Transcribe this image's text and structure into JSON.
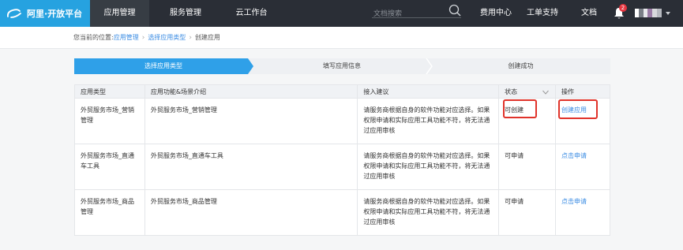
{
  "nav": {
    "logo_text": "阿里·开放平台",
    "items": [
      "应用管理",
      "服务管理",
      "云工作台"
    ],
    "search_placeholder": "文档搜索",
    "right_items": [
      "费用中心",
      "工单支持",
      "文档"
    ],
    "notification_count": "2"
  },
  "breadcrumb": {
    "prefix": "您当前的位置:",
    "items": [
      "应用管理",
      "选择应用类型",
      "创建应用"
    ]
  },
  "steps": [
    "选择应用类型",
    "填写应用信息",
    "创建成功"
  ],
  "table": {
    "headers": [
      "应用类型",
      "应用功能&场景介绍",
      "接入建议",
      "状态",
      "操作"
    ],
    "rows": [
      {
        "type": "外贸服务市场_营销管理",
        "intro": "外贸服务市场_营销管理",
        "advice": "请服务商根据自身的软件功能对应选择。如果权限申请和实际应用工具功能不符，将无法通过应用审核",
        "status": "可创建",
        "action": "创建应用"
      },
      {
        "type": "外贸服务市场_直通车工具",
        "intro": "外贸服务市场_直通车工具",
        "advice": "请服务商根据自身的软件功能对应选择。如果权限申请和实际应用工具功能不符，将无法通过应用审核",
        "status": "可申请",
        "action": "点击申请"
      },
      {
        "type": "外贸服务市场_商品管理",
        "intro": "外贸服务市场_商品管理",
        "advice": "请服务商根据自身的软件功能对应选择。如果权限申请和实际应用工具功能不符，将无法通过应用审核",
        "status": "可申请",
        "action": "点击申请"
      }
    ]
  },
  "colors": {
    "nav_bg": "#2a2e36",
    "logo_bg": "#26a2e0",
    "active_step": "#2fa0e8",
    "link": "#3b8ce3",
    "highlight": "#e0332a",
    "badge": "#e5353f"
  }
}
